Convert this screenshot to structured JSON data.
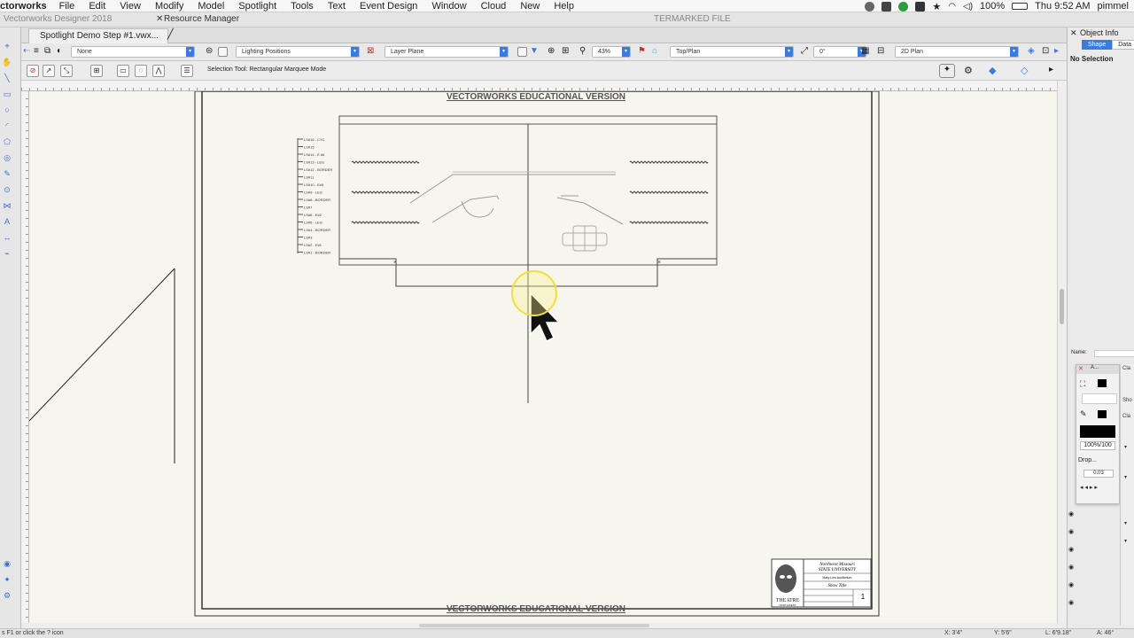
{
  "menubar": {
    "app_name": "ctorworks",
    "items": [
      "File",
      "Edit",
      "View",
      "Modify",
      "Model",
      "Spotlight",
      "Tools",
      "Text",
      "Event Design",
      "Window",
      "Cloud",
      "New",
      "Help"
    ],
    "battery": "100%",
    "clock": "Thu 9:52 AM",
    "user": "pimmel"
  },
  "title_strip": {
    "app_version": "Vectorworks Designer 2018",
    "resource_manager": "Resource Manager",
    "watermarked": "TERMARKED FILE"
  },
  "document_tab": "Spotlight Demo Step #1.vwx...",
  "view_bar": {
    "class_select": "None",
    "sheet_select": "Lighting Positions",
    "layer_select": "Layer Plane",
    "zoom": "43%",
    "view_select": "Top/Plan",
    "rotation": "0°",
    "render_select": "2D Plan"
  },
  "mode_bar": {
    "hint": "Selection Tool: Rectangular Marquee Mode"
  },
  "drawing": {
    "watermark_top": "VECTORWORKS EDUCATIONAL VERSION",
    "watermark_bottom": "VECTORWORKS EDUCATIONAL VERSION",
    "lineset_labels": [
      "LS#16 - CYC",
      "LS#15",
      "LS#14 - E #6",
      "LS#13 - LEG",
      "LS#12 - BORDER",
      "LS#11",
      "LS#10 - E#5",
      "LS#9 - LEG",
      "LS#8 - BORDER",
      "LS#7",
      "LS#6 - E#2",
      "LS#5 - LEG",
      "LS#4 - BORDER",
      "LS#3",
      "LS#2 - E#1",
      "LS#1 - BORDER"
    ],
    "title_block": {
      "org": "Northwest Missouri",
      "org2": "STATE UNIVERSITY",
      "venue": "Mary Linn Auditorium",
      "show": "Show Title",
      "sheet_no": "1",
      "logo_word": "THEATRE",
      "logo_sub": "NORTHWEST"
    }
  },
  "object_info": {
    "title": "Object Info",
    "tabs": [
      "Shape",
      "Data"
    ],
    "selection": "No Selection",
    "name_label": "Name:"
  },
  "attributes": {
    "header": "A...",
    "opacity": "100%/100",
    "drop_label": "Drop...",
    "thickness": "0.03"
  },
  "nav_panel": {
    "header": "Cla",
    "items": [
      "Sho",
      "Cla"
    ]
  },
  "status_bar": {
    "help_hint": "s F1 or click the ? icon",
    "x": "X: 3'4\"",
    "y": "Y: 5'6\"",
    "length": "L: 6'9.18\"",
    "angle": "A: 46°"
  }
}
